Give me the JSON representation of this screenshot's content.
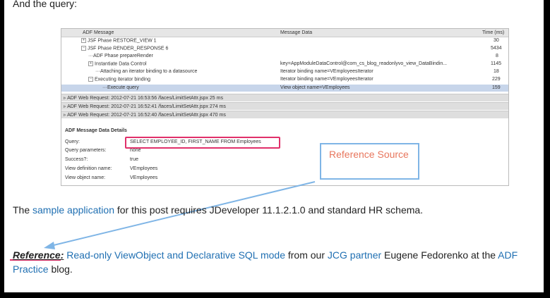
{
  "intro_text": "And the query:",
  "adf": {
    "headers": {
      "message": "ADF Message",
      "data": "Message Data",
      "time": "Time (ms)"
    },
    "rows": [
      {
        "label": "JSF Phase RESTORE_VIEW 1",
        "data": "",
        "time": "30"
      },
      {
        "label": "JSF Phase RENDER_RESPONSE 6",
        "data": "",
        "time": "5434"
      },
      {
        "label": "ADF Phase prepareRender",
        "data": "",
        "time": "8"
      },
      {
        "label": "Instantiate Data Control",
        "data": "key=AppModuleDataControl@com_cs_blog_readonlyvo_view_DataBindin...",
        "time": "1145"
      },
      {
        "label": "Attaching an iterator binding to a datasource",
        "data": "Iterator binding name=VEmployeesIterator",
        "time": "18"
      },
      {
        "label": "Executing iterator binding",
        "data": "Iterator binding name=VEmployeesIterator",
        "time": "229"
      },
      {
        "label": "Execute query",
        "data": "View object name=VEmployees",
        "time": "159"
      }
    ],
    "requests": [
      "ADF Web Request:  2012-07-21 16:53:56  /faces/LimitSetAttr.jspx  25 ms",
      "ADF Web Request:  2012-07-21 16:52:41  /faces/LimitSetAttr.jspx  274 ms",
      "ADF Web Request:  2012-07-21 16:52:40  /faces/LimitSetAttr.jspx  470 ms"
    ],
    "details_title": "ADF Message Data Details",
    "details": [
      {
        "key": "Query:",
        "value": "SELECT EMPLOYEE_ID,        FIRST_NAME FROM Employees"
      },
      {
        "key": "Query parameters:",
        "value": "none"
      },
      {
        "key": "Success?:",
        "value": "true"
      },
      {
        "key": "View definition name:",
        "value": "VEmployees"
      },
      {
        "key": "View object name:",
        "value": "VEmployees"
      }
    ]
  },
  "callout": "Reference Source",
  "para1": {
    "pre": "The ",
    "link": "sample application",
    "post": " for this post requires JDeveloper 11.1.2.1.0 and standard HR schema."
  },
  "para2": {
    "ref_label": "Reference:",
    "link1": "Read-only ViewObject and Declarative SQL mode",
    "t1": " from our ",
    "link2": "JCG partner",
    "t2": " Eugene Fedorenko at the ",
    "link3": "ADF Practice",
    "t3": " blog."
  },
  "colors": {
    "highlight_box": "#e0306a",
    "callout_border": "#7fb5e6",
    "callout_text": "#e8765d",
    "link": "#1f6fb2"
  }
}
